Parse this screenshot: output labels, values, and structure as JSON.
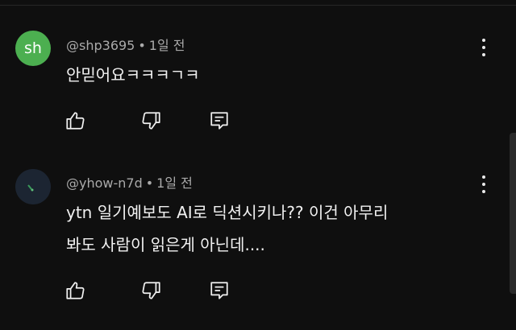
{
  "comments": [
    {
      "avatar_initials": "sh",
      "avatar_color": "#4caf50",
      "author": "@shp3695",
      "time": "1일 전",
      "lines": [
        "안믿어요ㅋㅋㅋㄱㅋ"
      ],
      "actions": [
        "like-icon",
        "dislike-icon",
        "reply-icon"
      ]
    },
    {
      "avatar_initials": "",
      "avatar_color": "#1c2532",
      "author": "@yhow-n7d",
      "time": "1일 전",
      "lines": [
        "ytn 일기예보도 AI로 딕션시키나??   이건 아무리",
        "봐도 사람이 읽은게 아닌데...."
      ],
      "actions": [
        "like-icon",
        "dislike-icon",
        "reply-icon"
      ]
    }
  ],
  "dot_separator": "•"
}
